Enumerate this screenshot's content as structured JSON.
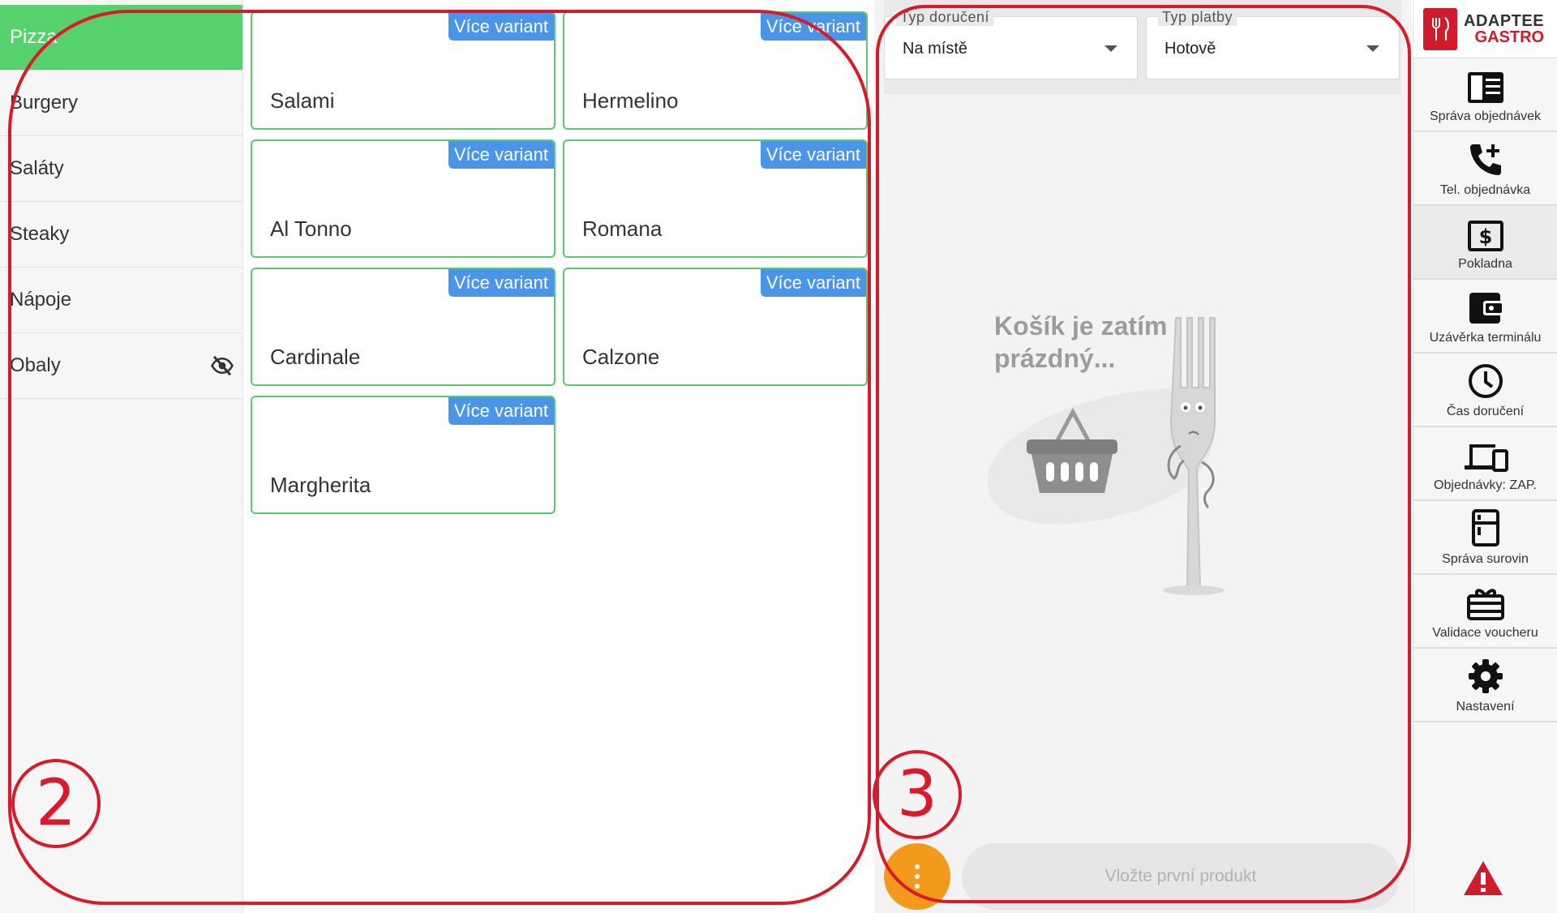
{
  "categories": [
    {
      "label": "Pizza",
      "active": true
    },
    {
      "label": "Burgery"
    },
    {
      "label": "Saláty"
    },
    {
      "label": "Steaky"
    },
    {
      "label": "Nápoje"
    },
    {
      "label": "Obaly",
      "hidden_icon": "eye-off-icon"
    }
  ],
  "products": [
    {
      "name": "Salami",
      "badge": "Více variant"
    },
    {
      "name": "Hermelino",
      "badge": "Více variant"
    },
    {
      "name": "Al Tonno",
      "badge": "Více variant"
    },
    {
      "name": "Romana",
      "badge": "Více variant"
    },
    {
      "name": "Cardinale",
      "badge": "Více variant"
    },
    {
      "name": "Calzone",
      "badge": "Více variant"
    },
    {
      "name": "Margherita",
      "badge": "Více variant"
    }
  ],
  "cart": {
    "delivery": {
      "label": "Typ doručení",
      "value": "Na místě"
    },
    "payment": {
      "label": "Typ platby",
      "value": "Hotově"
    },
    "empty_text": "Košík je zatím prázdný...",
    "add_first": "Vložte první produkt"
  },
  "nav": {
    "logo_top": "ADAPTEE",
    "logo_bottom": "GASTRO",
    "items": [
      {
        "label": "Správa objednávek",
        "icon": "order-list-icon"
      },
      {
        "label": "Tel. objednávka",
        "icon": "phone-add-icon"
      },
      {
        "label": "Pokladna",
        "icon": "cash-register-icon",
        "active": true
      },
      {
        "label": "Uzávěrka terminálu",
        "icon": "wallet-icon"
      },
      {
        "label": "Čas doručení",
        "icon": "clock-icon"
      },
      {
        "label": "Objednávky: ZAP.",
        "icon": "devices-icon"
      },
      {
        "label": "Správa surovin",
        "icon": "fridge-icon"
      },
      {
        "label": "Validace voucheru",
        "icon": "gift-card-icon"
      },
      {
        "label": "Nastavení",
        "icon": "gear-icon"
      }
    ]
  },
  "annotations": {
    "left_number": "2",
    "right_number": "3"
  },
  "colors": {
    "accent_green": "#56d16d",
    "badge_blue": "#4a95e8",
    "fab_orange": "#f39a1c",
    "brand_red": "#cf1b2b",
    "annotation_red": "#d91a2a"
  }
}
